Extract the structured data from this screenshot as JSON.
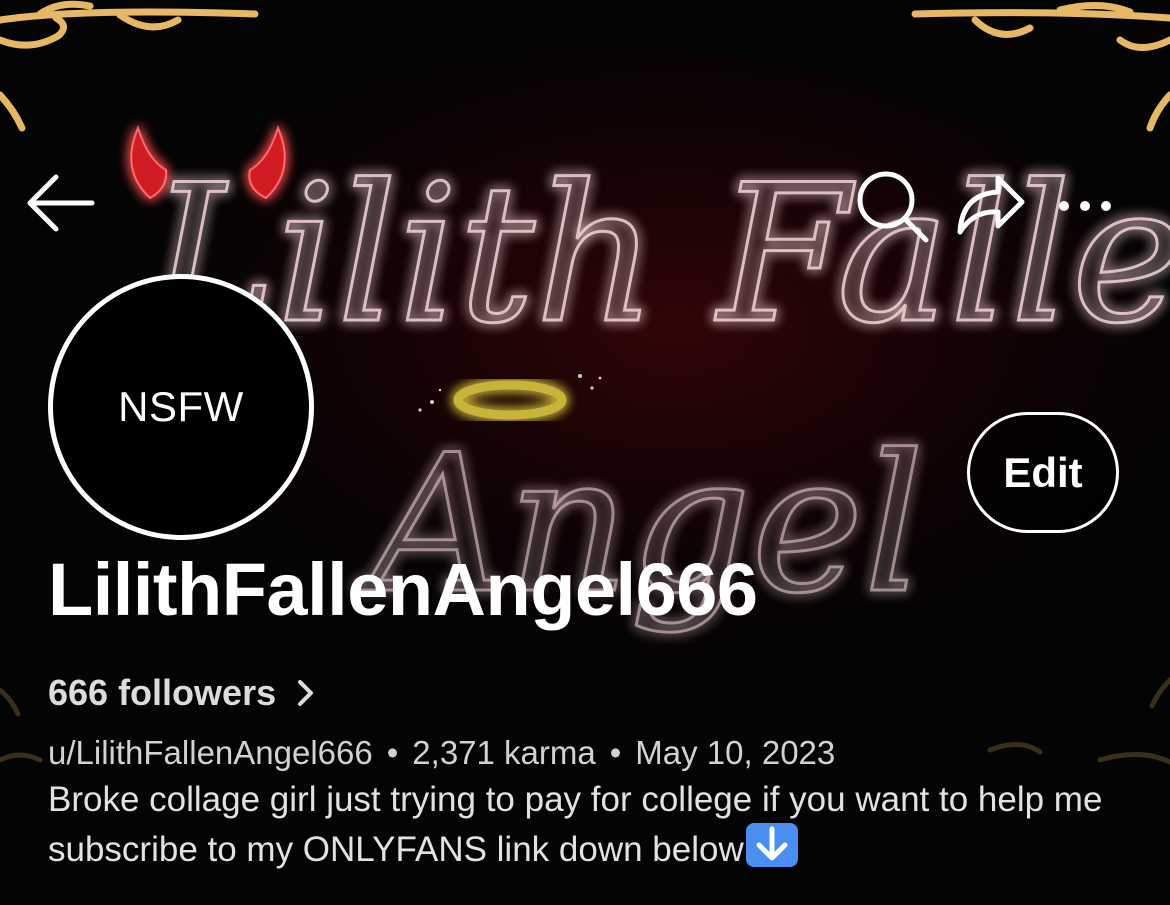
{
  "banner": {
    "script_line1": "Lilith Fallen",
    "script_line2": "Angel"
  },
  "nav": {
    "back_icon": "back-arrow-icon",
    "search_icon": "search-icon",
    "share_icon": "share-icon",
    "more_icon": "more-icon"
  },
  "avatar": {
    "label": "NSFW"
  },
  "edit_label": "Edit",
  "profile": {
    "display_name": "LilithFallenAngel666",
    "followers_label": "666 followers",
    "username": "u/LilithFallenAngel666",
    "separator": "•",
    "karma": "2,371 karma",
    "cake_day": "May 10, 2023",
    "bio": "Broke collage girl just trying to pay for college if you want to help me subscribe to my ONLYFANS link down below"
  },
  "colors": {
    "background": "#050505",
    "neon_red": "#c8141e",
    "neon_pink": "#f0d2d6",
    "gold": "#e6b866",
    "halo": "#c9b43a",
    "emoji_blue": "#4b8ef2"
  }
}
